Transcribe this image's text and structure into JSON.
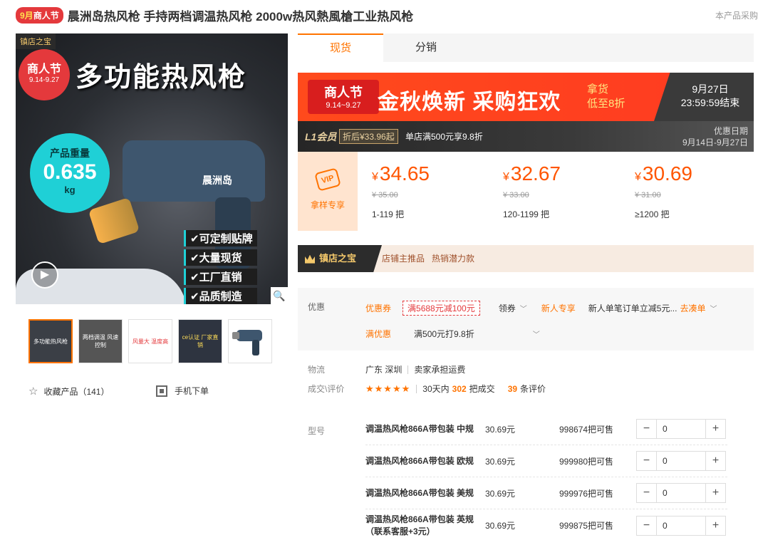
{
  "title": {
    "badge_month": "9月",
    "badge_text": "商人节",
    "product_title": "晨洲岛热风枪 手持两档调温热风枪 2000w热风熱風槍工业热风枪",
    "right_text": "本产品采购"
  },
  "gallery": {
    "store_tag": "镇店之宝",
    "fest_title": "商人节",
    "fest_dates": "9.14-9.27",
    "headline": "多功能热风枪",
    "weight_label": "产品重量",
    "weight_value": "0.635",
    "weight_unit": "kg",
    "gun_label": "晨洲岛",
    "features": [
      "✔可定制贴牌",
      "✔大量现货",
      "✔工厂直销",
      "✔品质制造"
    ],
    "thumbs": [
      {
        "text": "多功能热风枪",
        "bg": "#3b3f46"
      },
      {
        "text": "两档调温 风速控制",
        "bg": "#555"
      },
      {
        "text": "风量大 温度高",
        "bg": "#fff"
      },
      {
        "text": "ce认证 厂家直销",
        "bg": "#2e3440"
      },
      {
        "text": "",
        "bg": "#fff"
      }
    ]
  },
  "favorite": {
    "label": "收藏产品（141）"
  },
  "mobile_order": {
    "label": "手机下单"
  },
  "tabs": [
    {
      "label": "现货"
    },
    {
      "label": "分销"
    }
  ],
  "promo": {
    "fest_title": "商人节",
    "fest_dates": "9.14~9.27",
    "slogan": "金秋焕新 采购狂欢",
    "sub1": "拿货",
    "sub2": "低至8折",
    "deadline_date": "9月27日",
    "deadline_time": "23:59:59结束"
  },
  "l1": {
    "member": "L1会员",
    "discount": "折后¥33.96起",
    "full_discount": "单店满500元享9.8折",
    "period_label": "优惠日期",
    "period_value": "9月14日-9月27日"
  },
  "price": {
    "sample_label": "拿样专享",
    "sample_icon_text": "VIP",
    "currency": "¥",
    "tiers": [
      {
        "now": "34.65",
        "old": "¥ 35.00",
        "qty": "1-119 把"
      },
      {
        "now": "32.67",
        "old": "¥ 33.00",
        "qty": "120-1199 把"
      },
      {
        "now": "30.69",
        "old": "¥ 31.00",
        "qty": "≥1200 把"
      }
    ]
  },
  "treasure": {
    "label": "镇店之宝",
    "tag1": "店铺主推品",
    "tag2": "热销潜力款"
  },
  "offers": {
    "label": "优惠",
    "coupon_label": "优惠券",
    "coupon_value": "满5688元减100元",
    "claim_label": "领券",
    "newbie_label": "新人专享",
    "newbie_text": "新人单笔订单立减5元...",
    "newbie_link": "去凑单",
    "full_label": "满优惠",
    "full_text": "满500元打9.8折"
  },
  "logistics": {
    "label": "物流",
    "location": "广东 深圳",
    "shipping": "卖家承担运费"
  },
  "reviews": {
    "label": "成交\\评价",
    "stars": "★★★★★",
    "deals_prefix": "30天内",
    "deals_count": "302",
    "deals_suffix": "把成交",
    "review_count": "39",
    "review_suffix": "条评价"
  },
  "sku": {
    "label": "型号",
    "rows": [
      {
        "name": "调温热风枪866A带包装 中规",
        "price": "30.69元",
        "stock": "998674把可售",
        "qty": "0"
      },
      {
        "name": "调温热风枪866A带包装 欧规",
        "price": "30.69元",
        "stock": "999980把可售",
        "qty": "0"
      },
      {
        "name": "调温热风枪866A带包装 美规",
        "price": "30.69元",
        "stock": "999976把可售",
        "qty": "0"
      },
      {
        "name": "调温热风枪866A带包装 英规（联系客服+3元）",
        "price": "30.69元",
        "stock": "999875把可售",
        "qty": "0"
      }
    ]
  },
  "colors": {
    "accent": "#ff7300",
    "price": "#ff5500",
    "red": "#e4393c"
  }
}
